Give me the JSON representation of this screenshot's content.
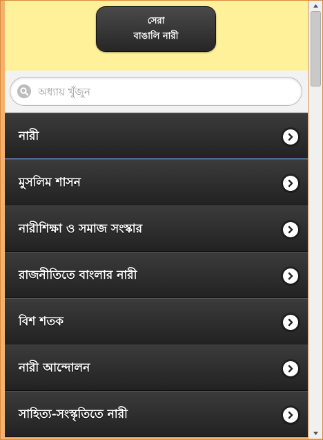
{
  "header": {
    "title_line1": "সেরা",
    "title_line2": "বাঙালি নারী"
  },
  "search": {
    "placeholder": "অধ্যায় খুঁজুন",
    "value": ""
  },
  "chapters": [
    "নারী",
    "মুসলিম শাসন",
    "নারীশিক্ষা ও সমাজ সংস্কার",
    "রাজনীতিতে বাংলার নারী",
    "বিশ শতক",
    "নারী আন্দোলন",
    "সাহিত্য-সংস্কৃতিতে নারী"
  ],
  "colors": {
    "header_bg": "#fff09a",
    "list_bg": "#2b2b2b",
    "frame": "#f3b36e"
  },
  "icons": {
    "search": "search-icon",
    "chevron": "chevron-right-icon"
  }
}
